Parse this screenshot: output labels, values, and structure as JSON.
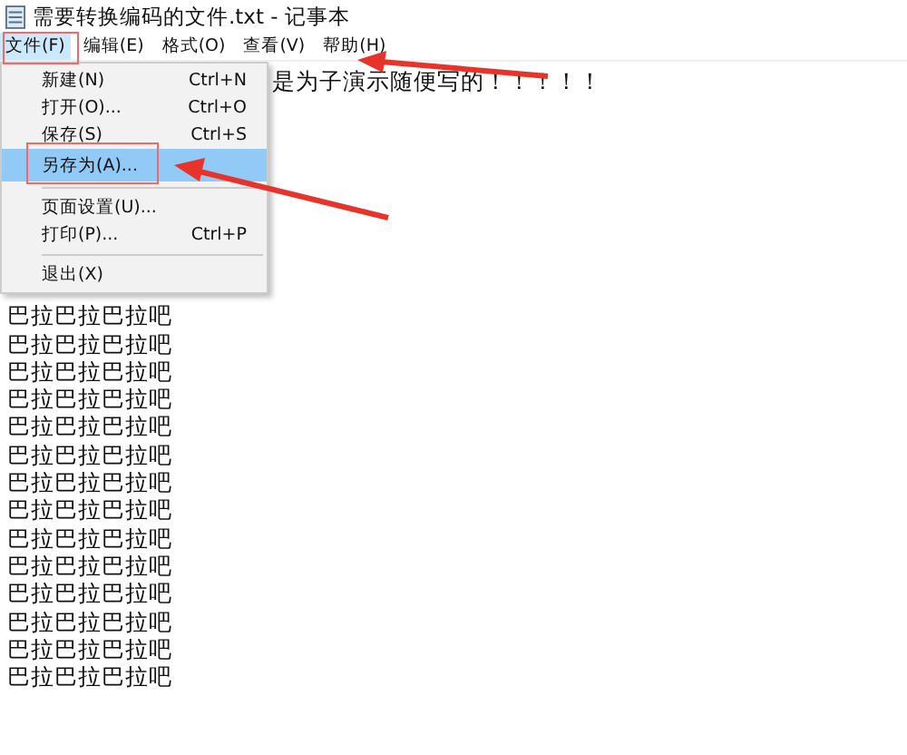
{
  "window": {
    "title": "需要转换编码的文件.txt - 记事本"
  },
  "menu_bar": [
    {
      "label": "文件(F)",
      "selected": true
    },
    {
      "label": "编辑(E)",
      "selected": false
    },
    {
      "label": "格式(O)",
      "selected": false
    },
    {
      "label": "查看(V)",
      "selected": false
    },
    {
      "label": "帮助(H)",
      "selected": false
    }
  ],
  "file_menu": [
    {
      "kind": "item",
      "label": "新建(N)",
      "shortcut": "Ctrl+N",
      "selected": false
    },
    {
      "kind": "item",
      "label": "打开(O)...",
      "shortcut": "Ctrl+O",
      "selected": false
    },
    {
      "kind": "item",
      "label": "保存(S)",
      "shortcut": "Ctrl+S",
      "selected": false
    },
    {
      "kind": "item",
      "label": "另存为(A)...",
      "selected": true
    },
    {
      "kind": "separator"
    },
    {
      "kind": "item",
      "label": "页面设置(U)...",
      "selected": false
    },
    {
      "kind": "item",
      "label": "打印(P)...",
      "shortcut": "Ctrl+P",
      "selected": false
    },
    {
      "kind": "separator"
    },
    {
      "kind": "item",
      "label": "退出(X)",
      "selected": false
    }
  ],
  "editor": {
    "first_line": "是为子演示随便写的！！！！！",
    "lines": [
      "巴拉巴拉巴拉吧",
      "巴拉巴拉巴拉吧",
      "巴拉巴拉巴拉吧",
      "巴拉巴拉巴拉吧",
      "巴拉巴拉巴拉吧",
      "巴拉巴拉巴拉吧",
      "巴拉巴拉巴拉吧",
      "巴拉巴拉巴拉吧",
      "巴拉巴拉巴拉吧",
      "巴拉巴拉巴拉吧",
      "巴拉巴拉巴拉吧",
      "巴拉巴拉巴拉吧",
      "巴拉巴拉巴拉吧",
      "巴拉巴拉巴拉吧"
    ]
  }
}
